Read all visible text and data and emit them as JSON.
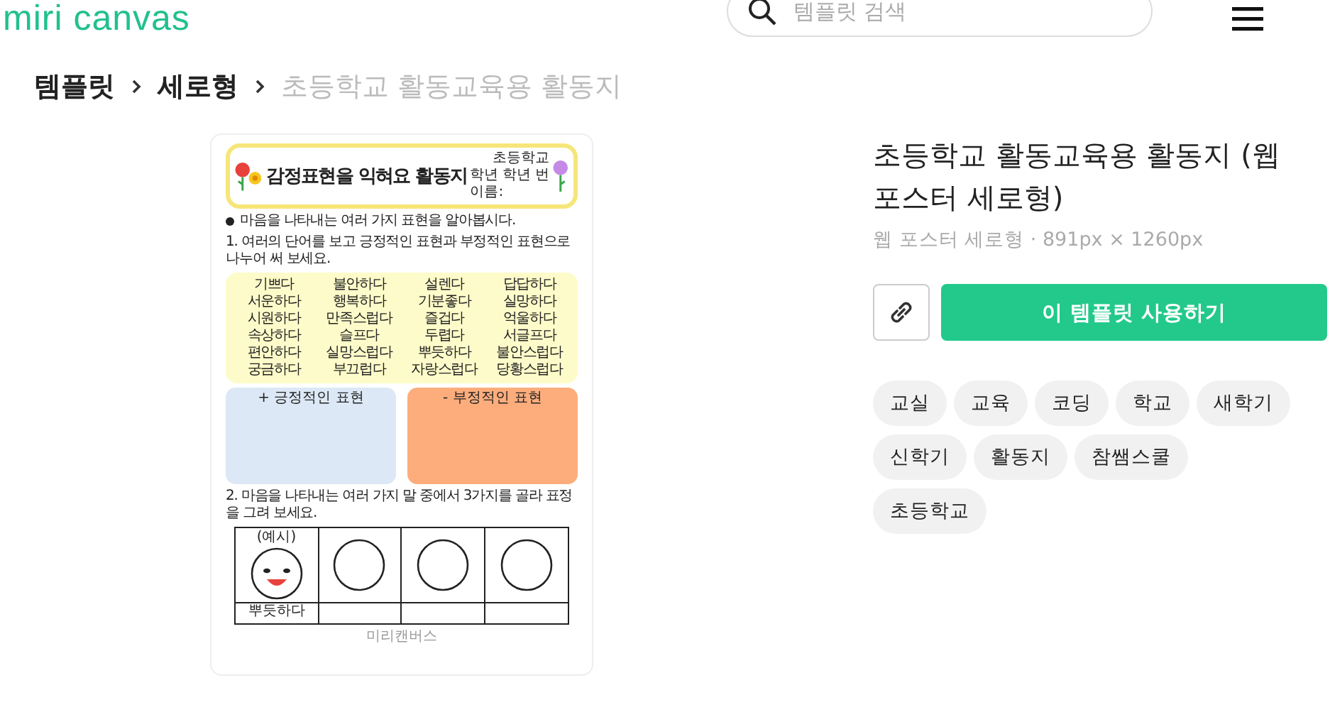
{
  "header": {
    "logo": "miri canvas",
    "search": {
      "placeholder": "템플릿 검색"
    }
  },
  "breadcrumb": [
    {
      "label": "템플릿",
      "current": false
    },
    {
      "label": "세로형",
      "current": false
    },
    {
      "label": "초등학교 활동교육용 활동지",
      "current": true
    }
  ],
  "preview": {
    "title": "감정표현을 익혀요 활동지",
    "school": "초등학교",
    "class_fields": [
      "학년",
      "학년",
      "번"
    ],
    "name_label": "이름:",
    "intro": "마음을 나타내는 여러 가지 표현을 알아봅시다.",
    "q1": "1. 여러의 단어를 보고 긍정적인 표현과 부정적인 표현으로 나누어 써 보세요.",
    "words": [
      "기쁘다",
      "불안하다",
      "설렌다",
      "답답하다",
      "서운하다",
      "행복하다",
      "기분좋다",
      "실망하다",
      "시원하다",
      "만족스럽다",
      "즐겁다",
      "억울하다",
      "속상하다",
      "슬프다",
      "두렵다",
      "서글프다",
      "편안하다",
      "실망스럽다",
      "뿌듯하다",
      "불안스럽다",
      "궁금하다",
      "부끄럽다",
      "자랑스럽다",
      "당황스럽다"
    ],
    "positive_label": "+ 긍정적인 표현",
    "negative_label": "- 부정적인 표현",
    "q2": "2. 마음을 나타내는 여러 가지 말 중에서 3가지를 골라 표정을 그려 보세요.",
    "example_label": "(예시)",
    "example_word": "뿌듯하다",
    "faces": [
      {
        "kind": "example"
      },
      {
        "kind": "blank"
      },
      {
        "kind": "blank"
      },
      {
        "kind": "blank"
      }
    ],
    "footer": "미리캔버스"
  },
  "detail": {
    "title": "초등학교 활동교육용 활동지 (웹 포스터 세로형)",
    "meta": "웹 포스터 세로형 · 891px × 1260px",
    "use_button": "이 템플릿 사용하기",
    "tags": [
      "교실",
      "교육",
      "코딩",
      "학교",
      "새학기",
      "신학기",
      "활동지",
      "참쌤스쿨",
      "초등학교"
    ]
  }
}
